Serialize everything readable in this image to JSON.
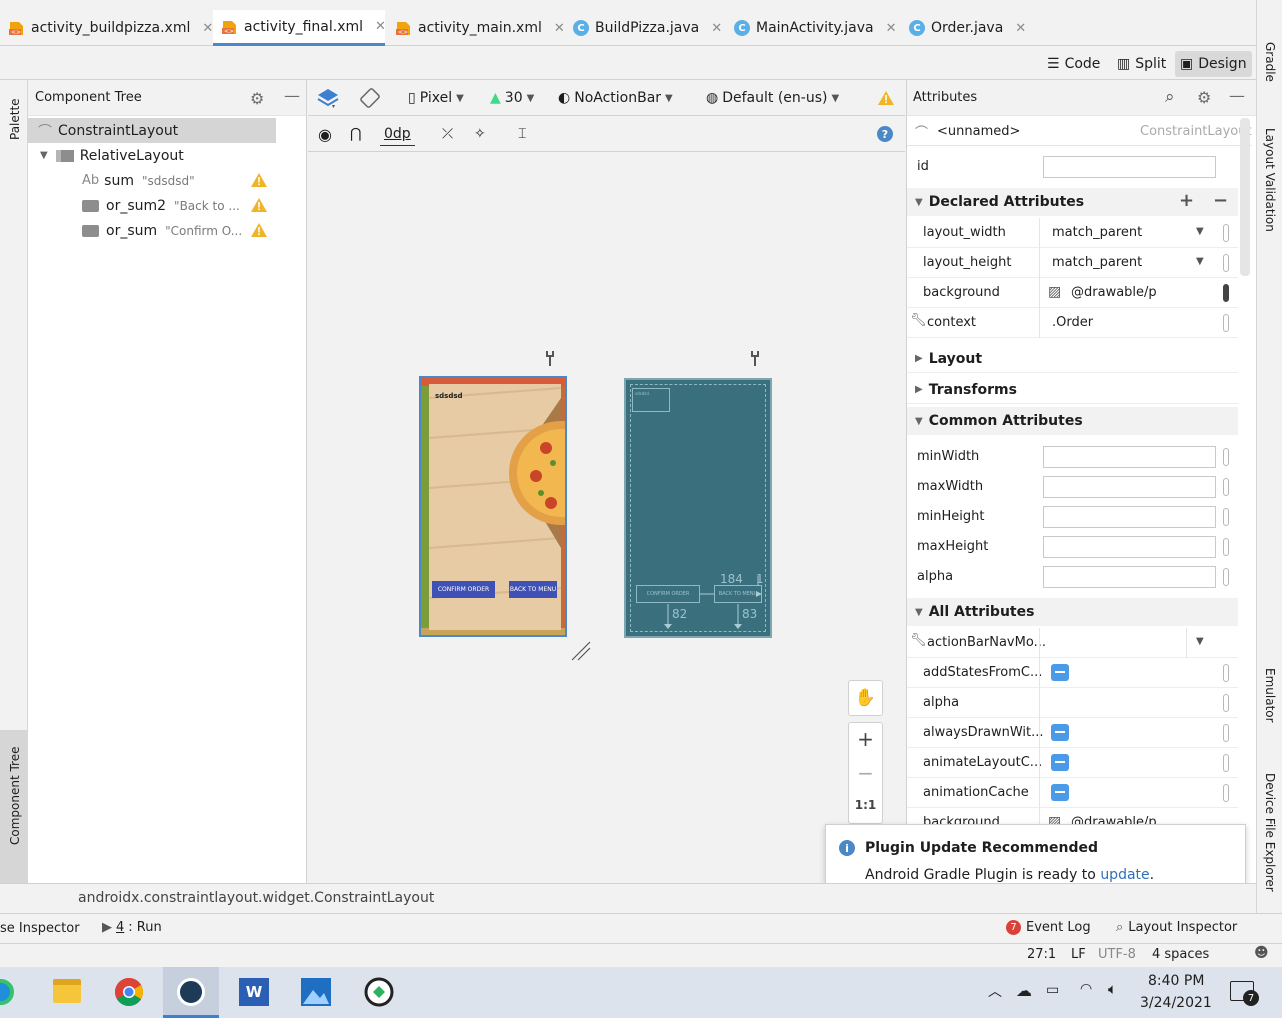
{
  "tabs": [
    {
      "label": "activity_buildpizza.xml",
      "kind": "xml",
      "active": false
    },
    {
      "label": "activity_final.xml",
      "kind": "xml",
      "active": true
    },
    {
      "label": "activity_main.xml",
      "kind": "xml",
      "active": false
    },
    {
      "label": "BuildPizza.java",
      "kind": "class",
      "active": false
    },
    {
      "label": "MainActivity.java",
      "kind": "class",
      "active": false
    },
    {
      "label": "Order.java",
      "kind": "class",
      "active": false
    }
  ],
  "class_letter": "C",
  "view_modes": {
    "code": "Code",
    "split": "Split",
    "design": "Design"
  },
  "right_strip": {
    "gradle": "Gradle",
    "layout_validation": "Layout Validation",
    "emulator": "Emulator",
    "device_file_explorer": "Device File Explorer"
  },
  "left_strip": {
    "palette": "Palette",
    "component_tree": "Component Tree"
  },
  "component_tree": {
    "title": "Component Tree",
    "root": "ConstraintLayout",
    "child": "RelativeLayout",
    "items": [
      {
        "icon": "Ab",
        "name": "sum",
        "sub": "\"sdsdsd\""
      },
      {
        "name": "or_sum2",
        "sub": "\"Back to ..."
      },
      {
        "name": "or_sum",
        "sub": "\"Confirm O..."
      }
    ]
  },
  "design_toolbar": {
    "device": "Pixel",
    "api": "30",
    "theme": "NoActionBar",
    "locale": "Default (en-us)",
    "margin": "0dp",
    "help": "?"
  },
  "preview": {
    "text": "sdsdsd",
    "confirm_button": "CONFIRM ORDER",
    "back_button": "BACK TO MENU"
  },
  "blueprint": {
    "label1": "sdsdsd",
    "confirm": "CONFIRM ORDER",
    "back": "BACK TO MENU",
    "num_184": "184",
    "num_1": "1",
    "num_82": "82",
    "num_83": "83"
  },
  "zoom": {
    "fit": "1:1"
  },
  "attributes": {
    "title": "Attributes",
    "component": "<unnamed>",
    "component_type": "ConstraintLayout",
    "id_label": "id",
    "declared_title": "Declared Attributes",
    "declared": [
      {
        "key": "layout_width",
        "value": "match_parent"
      },
      {
        "key": "layout_height",
        "value": "match_parent"
      },
      {
        "key": "background",
        "value": "@drawable/p"
      },
      {
        "key": "context",
        "value": ".Order"
      }
    ],
    "layout": "Layout",
    "transforms": "Transforms",
    "common_title": "Common Attributes",
    "common": [
      "minWidth",
      "maxWidth",
      "minHeight",
      "maxHeight",
      "alpha"
    ],
    "all_title": "All Attributes",
    "all": [
      "actionBarNavMo...",
      "addStatesFromC...",
      "alpha",
      "alwaysDrawnWit...",
      "animateLayoutC...",
      "animationCache",
      "background"
    ],
    "all_background_value": "@drawable/p"
  },
  "notification": {
    "title": "Plugin Update Recommended",
    "body": "Android Gradle Plugin is ready to",
    "link": "update",
    "end": "."
  },
  "path_bar": "androidx.constraintlayout.widget.ConstraintLayout",
  "bottom_tools": {
    "left": "se Inspector",
    "run_num": "4",
    "run": ": Run",
    "event_log": "Event Log",
    "event_count": "7",
    "layout_inspector": "Layout Inspector"
  },
  "status": {
    "position": "27:1",
    "line_sep": "LF",
    "encoding": "UTF-8",
    "indent": "4 spaces"
  },
  "taskbar": {
    "time": "8:40 PM",
    "date": "3/24/2021",
    "notif_count": "7"
  },
  "colors": {
    "accent": "#4a88c7",
    "blueprint": "#3a6f7e",
    "button": "#3f51b5",
    "warning": "#f0b429",
    "info": "#4a88c7"
  }
}
